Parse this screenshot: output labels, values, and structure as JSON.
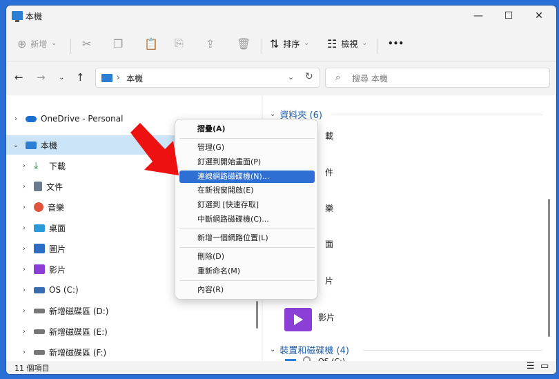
{
  "window": {
    "title": "本機",
    "controls": [
      "—",
      "☐",
      "✕"
    ]
  },
  "commandbar": {
    "new_label": "新增",
    "sort_label": "排序",
    "view_label": "檢視",
    "more_label": "•••"
  },
  "addressbar": {
    "crumb": "本機",
    "search_placeholder": "搜尋 本機"
  },
  "nav": {
    "items": [
      {
        "label": "OneDrive - Personal",
        "icon": "cloud-icon",
        "color": "#1b6fd1"
      },
      {
        "label": "本機",
        "icon": "computer-icon",
        "color": "#2d7fd3"
      },
      {
        "label": "下載",
        "icon": "download-icon",
        "color": "#2a8a3e"
      },
      {
        "label": "文件",
        "icon": "document-icon",
        "color": "#6b7a8c"
      },
      {
        "label": "音樂",
        "icon": "music-icon",
        "color": "#e0533c"
      },
      {
        "label": "桌面",
        "icon": "desktop-icon",
        "color": "#2a9ad8"
      },
      {
        "label": "圖片",
        "icon": "pictures-icon",
        "color": "#2b6ec4"
      },
      {
        "label": "影片",
        "icon": "videos-icon",
        "color": "#8c3fd6"
      },
      {
        "label": "OS (C:)",
        "icon": "drive-icon",
        "color": "#3a6ab0"
      },
      {
        "label": "新增磁碟區 (D:)",
        "icon": "drive-icon",
        "color": "#777777"
      },
      {
        "label": "新增磁碟區 (E:)",
        "icon": "drive-icon",
        "color": "#777777"
      },
      {
        "label": "新增磁碟區 (F:)",
        "icon": "drive-icon",
        "color": "#777777"
      }
    ]
  },
  "main": {
    "folders_header": "資料夾 (6)",
    "devices_header": "裝置和磁碟機 (4)",
    "partial_labels": [
      "載",
      "件",
      "樂",
      "面",
      "片"
    ],
    "videos_label": "影片",
    "os_label": "OS (C:)"
  },
  "context_menu": {
    "items": [
      {
        "label": "摺疊(A)",
        "bold": true,
        "highlight": false
      },
      {
        "label": "管理(G)",
        "bold": false,
        "highlight": false
      },
      {
        "label": "釘選到開始畫面(P)",
        "bold": false,
        "highlight": false
      },
      {
        "label": "連線網路磁碟機(N)...",
        "bold": false,
        "highlight": true
      },
      {
        "label": "在新視窗開啟(E)",
        "bold": false,
        "highlight": false
      },
      {
        "label": "釘選到 [快速存取]",
        "bold": false,
        "highlight": false
      },
      {
        "label": "中斷網路磁碟機(C)...",
        "bold": false,
        "highlight": false
      },
      {
        "label": "新增一個網路位置(L)",
        "bold": false,
        "highlight": false
      },
      {
        "label": "刪除(D)",
        "bold": false,
        "highlight": false
      },
      {
        "label": "重新命名(M)",
        "bold": false,
        "highlight": false
      },
      {
        "label": "內容(R)",
        "bold": false,
        "highlight": false
      }
    ]
  },
  "status": {
    "count": "11 個項目"
  },
  "colors": {
    "accent": "#2e6fd4",
    "selection": "#cce4f7",
    "arrow": "#ee1111"
  }
}
